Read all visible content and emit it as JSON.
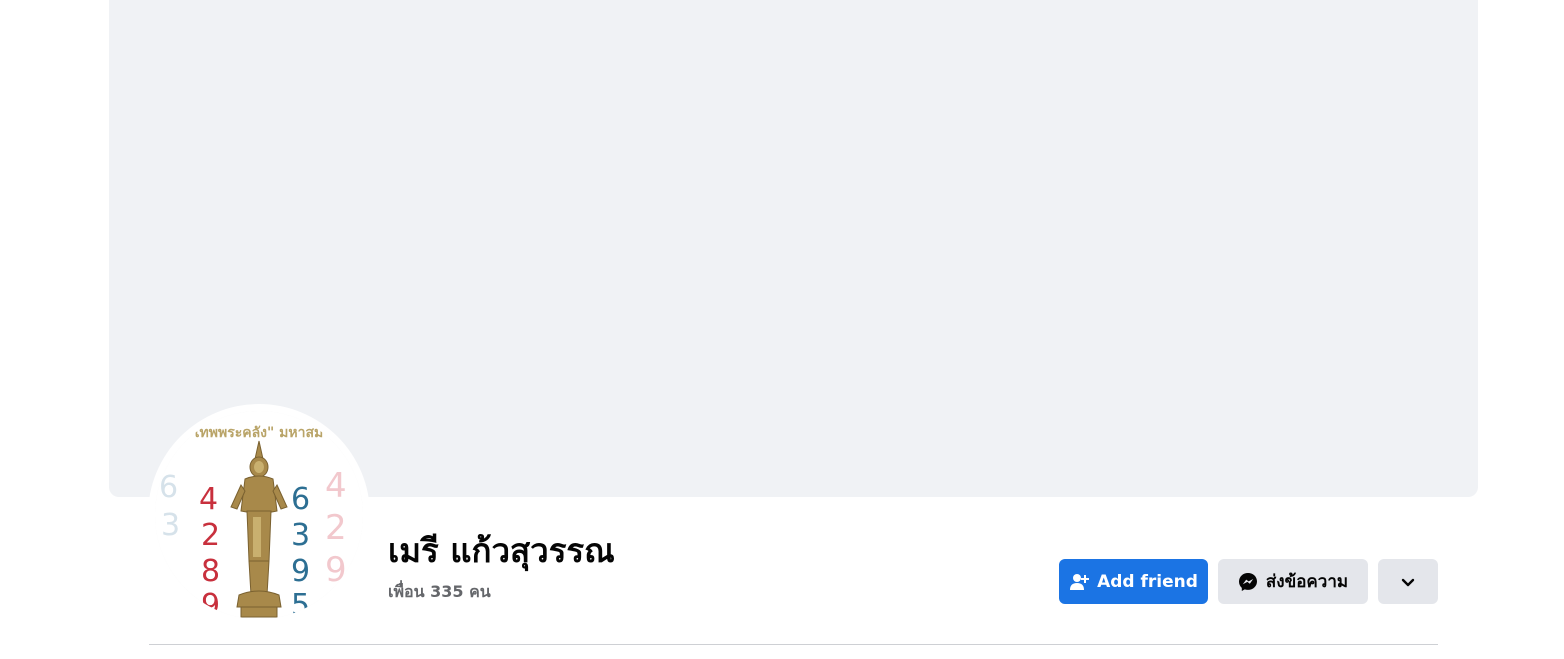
{
  "profile": {
    "name": "เมรี แก้วสุวรรณ",
    "friends_text": "เพื่อน 335 คน",
    "avatar_caption": "เทพพระคลัง\" มหาสม"
  },
  "actions": {
    "add_friend_label": "Add friend",
    "message_label": "ส่งข้อความ"
  },
  "icons": {
    "add_friend": "add-friend-icon",
    "message": "messenger-icon",
    "more": "chevron-down-icon"
  },
  "colors": {
    "primary": "#1b74e4",
    "secondary_button": "#e4e6eb",
    "cover": "#f0f2f5",
    "secondary_text": "#65676b"
  }
}
